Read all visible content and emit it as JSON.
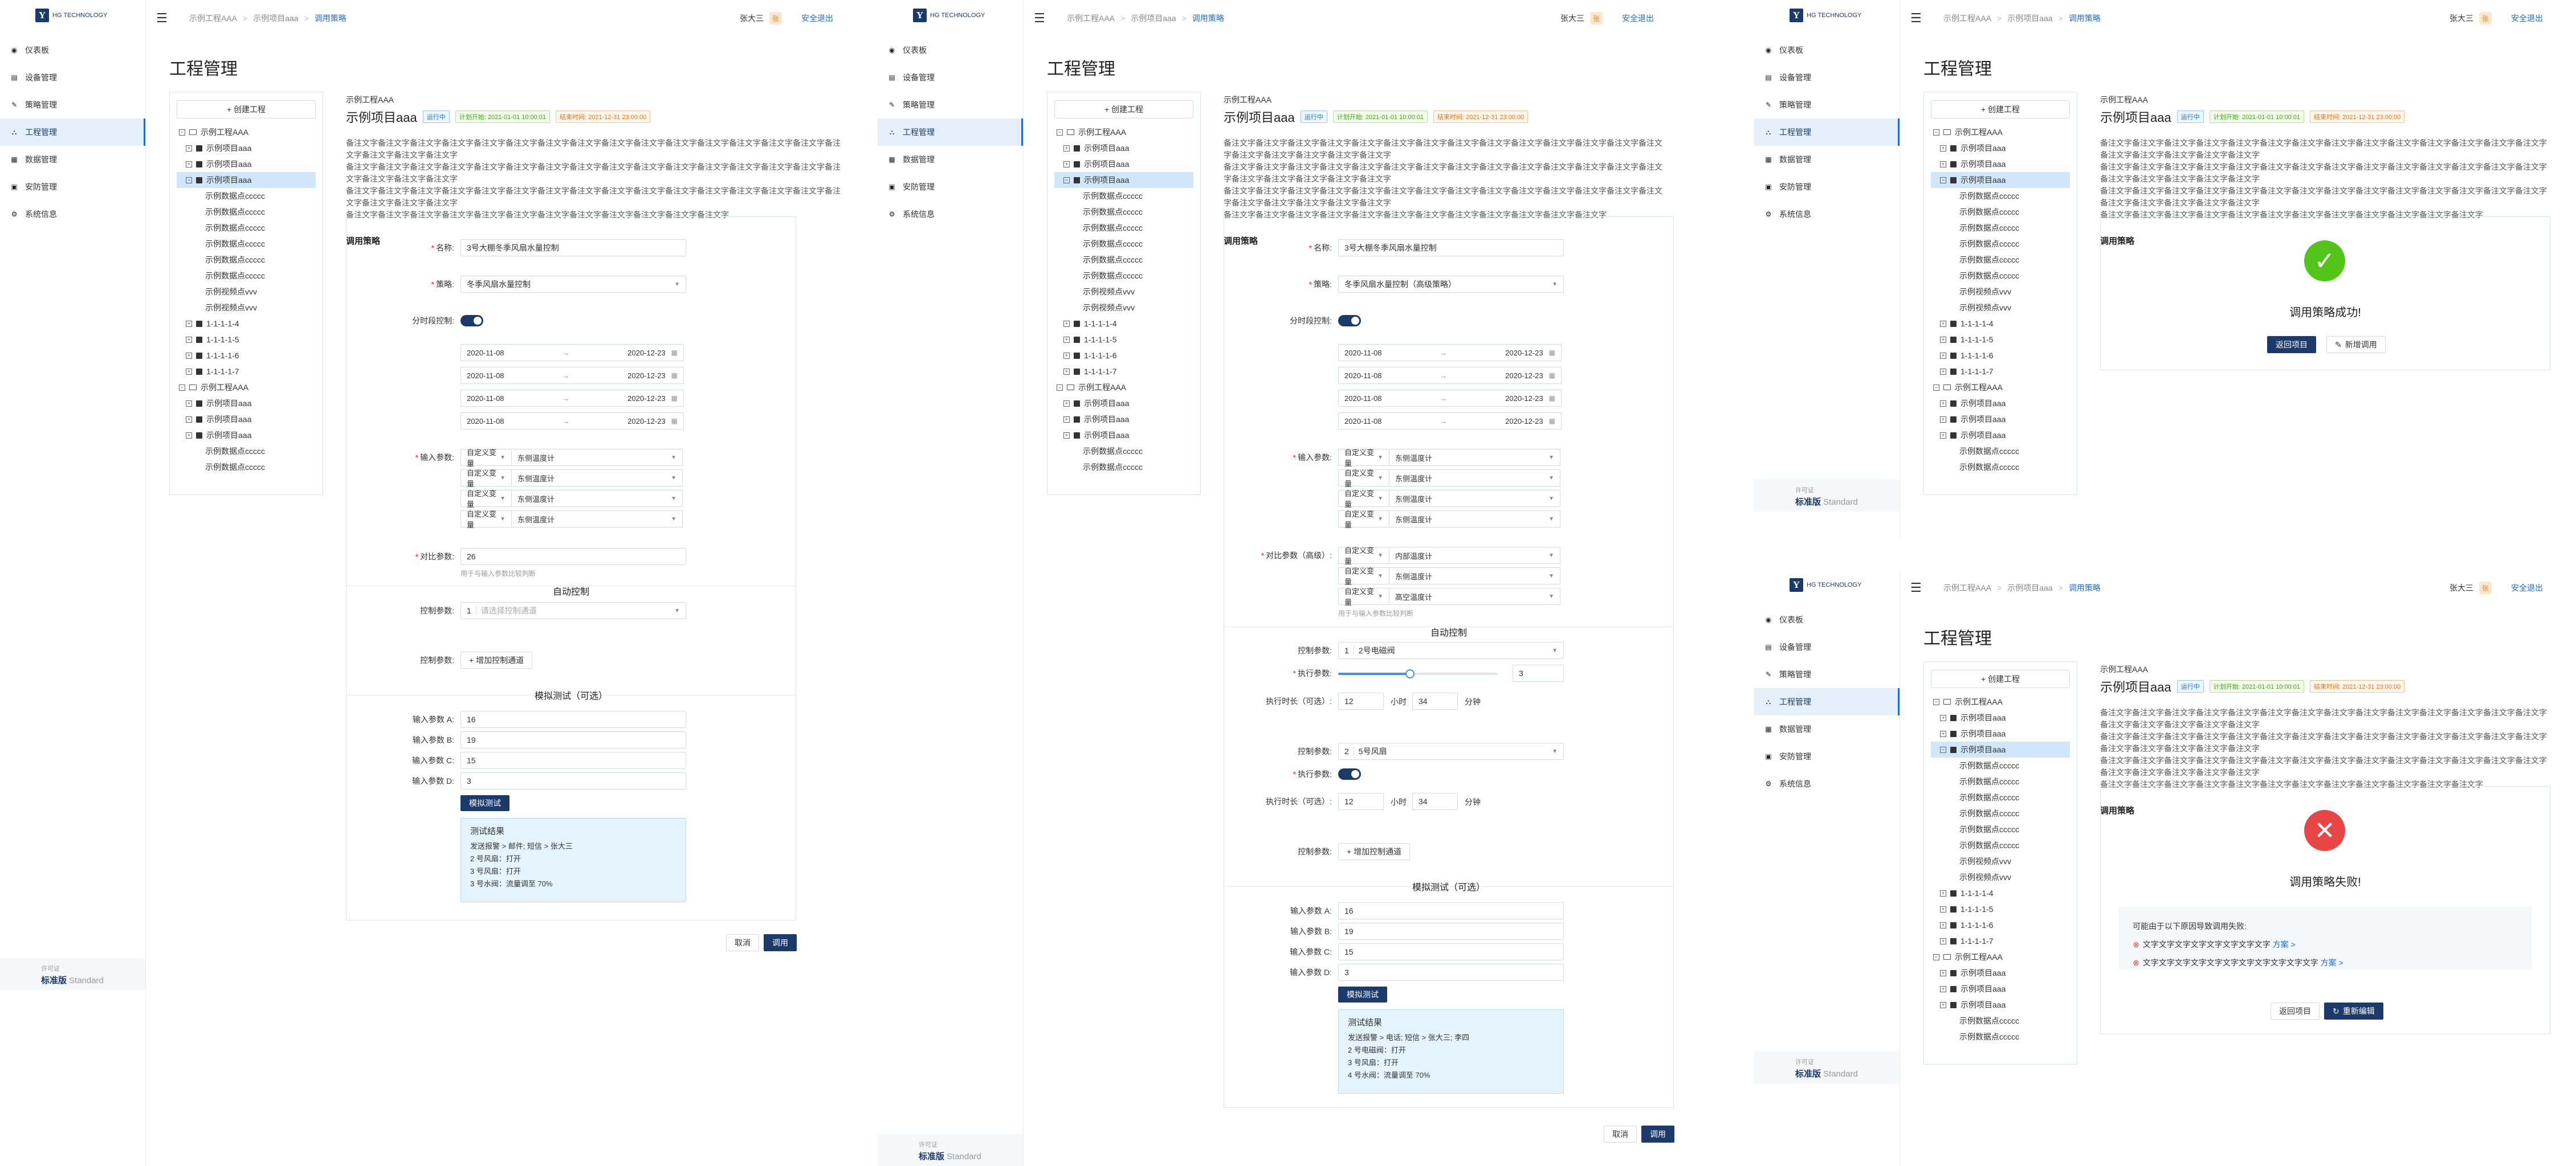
{
  "logo_text": "HG TECHNOLOGY",
  "logo_letter": "Y",
  "nav": [
    "仪表板",
    "设备管理",
    "策略管理",
    "工程管理",
    "数据管理",
    "安防管理",
    "系统信息"
  ],
  "version": {
    "label": "许可证",
    "name": "标准版",
    "sub": "Standard"
  },
  "crumbs": [
    "示例工程AAA",
    "示例项目aaa",
    "调用策略"
  ],
  "user": {
    "name": "张大三",
    "avatar": "张",
    "logout": "安全退出"
  },
  "page_title": "工程管理",
  "tree": {
    "create": "+ 创建工程",
    "nodes": [
      {
        "t": "示例工程AAA",
        "lvl": 0,
        "kind": "folder",
        "tog": "−"
      },
      {
        "t": "示例项目aaa",
        "lvl": 1,
        "kind": "sq",
        "tog": "+"
      },
      {
        "t": "示例项目aaa",
        "lvl": 1,
        "kind": "sq",
        "tog": "+"
      },
      {
        "t": "示例项目aaa",
        "lvl": 1,
        "kind": "sq",
        "tog": "−",
        "sel": true
      },
      {
        "t": "示例数据点ccccc",
        "lvl": 2
      },
      {
        "t": "示例数据点ccccc",
        "lvl": 2
      },
      {
        "t": "示例数据点ccccc",
        "lvl": 2
      },
      {
        "t": "示例数据点ccccc",
        "lvl": 2
      },
      {
        "t": "示例数据点ccccc",
        "lvl": 2
      },
      {
        "t": "示例数据点ccccc",
        "lvl": 2
      },
      {
        "t": "示例视频点vvv",
        "lvl": 2
      },
      {
        "t": "示例视频点vvv",
        "lvl": 2
      },
      {
        "t": "1-1-1-1-4",
        "lvl": 1,
        "kind": "sq",
        "tog": "+"
      },
      {
        "t": "1-1-1-1-5",
        "lvl": 1,
        "kind": "sq",
        "tog": "+"
      },
      {
        "t": "1-1-1-1-6",
        "lvl": 1,
        "kind": "sq",
        "tog": "+"
      },
      {
        "t": "1-1-1-1-7",
        "lvl": 1,
        "kind": "sq",
        "tog": "+"
      },
      {
        "t": "示例工程AAA",
        "lvl": 0,
        "kind": "folder",
        "tog": "−"
      },
      {
        "t": "示例项目aaa",
        "lvl": 1,
        "kind": "sq",
        "tog": "+"
      },
      {
        "t": "示例项目aaa",
        "lvl": 1,
        "kind": "sq",
        "tog": "+"
      },
      {
        "t": "示例项目aaa",
        "lvl": 1,
        "kind": "sq",
        "tog": "+"
      },
      {
        "t": "示例数据点ccccc",
        "lvl": 2
      },
      {
        "t": "示例数据点ccccc",
        "lvl": 2
      }
    ]
  },
  "context": {
    "project": "示例工程AAA",
    "title": "示例项目aaa",
    "status": "运行中",
    "planned": "计划开始: 2021-01-01 10:00:01",
    "deadline": "结束时间: 2021-12-31 23:00:00",
    "desc1": "备注文字备注文字备注文字备注文字备注文字备注文字备注文字备注文字备注文字备注文字备注文字备注文字备注文字备注文字备注文字备注文字备注文字备注文字备注文字",
    "desc2": "备注文字备注文字备注文字备注文字备注文字备注文字备注文字备注文字备注文字备注文字备注文字备注文字备注文字备注文字备注文字备注文字备注文字备注文字备注文字",
    "desc3": "备注文字备注文字备注文字备注文字备注文字备注文字备注文字备注文字备注文字备注文字备注文字备注文字备注文字备注文字备注文字备注文字备注文字备注文字备注文字",
    "desc4": "备注文字备注文字备注文字备注文字备注文字备注文字备注文字备注文字备注文字备注文字备注文字备注文字",
    "section": "调用策略"
  },
  "form": {
    "name_label": "名称:",
    "name_value": "3号大棚冬季风扇水量控制",
    "strategy_label": "策略:",
    "strategy_value": "冬季风扇水量控制",
    "strategy_value_adv": "冬季风扇水量控制（高级策略）",
    "timectl_label": "分时段控制:",
    "dates": [
      [
        "2020-11-08",
        "2020-12-23"
      ],
      [
        "2020-11-08",
        "2020-12-23"
      ],
      [
        "2020-11-08",
        "2020-12-23"
      ],
      [
        "2020-11-08",
        "2020-12-23"
      ]
    ],
    "input_label": "输入参数:",
    "inputs": [
      [
        "自定义变量",
        "东侧温度计"
      ],
      [
        "自定义变量",
        "东侧温度计"
      ],
      [
        "自定义变量",
        "东侧温度计"
      ],
      [
        "自定义变量",
        "东侧温度计"
      ]
    ],
    "compare_label": "对比参数:",
    "compare_value": "26",
    "compare_hint": "用于与输入参数比较判断",
    "compare_label_adv": "对比参数（高级）:",
    "compare_adv": [
      [
        "自定义变量",
        "内部温度计"
      ],
      [
        "自定义变量",
        "东侧温度计"
      ],
      [
        "自定义变量",
        "高空温度计"
      ]
    ],
    "auto_title": "自动控制",
    "ctrl_label": "控制参数:",
    "ctrl_num": "1",
    "ctrl_placeholder": "请选择控制通道",
    "ctrl2_label": "控制参数:",
    "add_ctrl": "+ 增加控制通道",
    "exec_label": "执行参数:",
    "exec_value": "3",
    "ctrl1_value": "2号电磁阀",
    "ctrl2_num": "2",
    "ctrl2_value": "5号风扇",
    "exec_time_label": "执行时长（可选）:",
    "hours": "12",
    "hours_unit": "小时",
    "mins": "34",
    "mins_unit": "分钟",
    "sim_title": "模拟测试（可选）",
    "sim": [
      [
        "输入参数 A:",
        "16"
      ],
      [
        "输入参数 B:",
        "19"
      ],
      [
        "输入参数 C:",
        "15"
      ],
      [
        "输入参数 D:",
        "3"
      ]
    ],
    "sim_btn": "模拟测试",
    "result_title": "测试结果",
    "result_lines": [
      "发送报警 > 邮件; 短信 > 张大三",
      "2 号风扇：打开",
      "3 号风扇：打开",
      "3 号水阀：流量调至 70%"
    ],
    "result_lines_adv": [
      "发送报警 > 电话; 短信 > 张大三; 李四",
      "2 号电磁阀：打开",
      "3 号风扇：打开",
      "4 号水阀：流量调至 70%"
    ],
    "cancel": "取消",
    "submit": "调用"
  },
  "success": {
    "title": "调用策略成功!",
    "back": "返回项目",
    "again": "新增调用"
  },
  "fail": {
    "title": "调用策略失败!",
    "reason_title": "可能由于以下原因导致调用失败:",
    "reasons": [
      "文字文字文字文字文字文字文字文字",
      "文字文字文字文字文字文字文字文字文字文字文字"
    ],
    "link": "方案 >",
    "back": "返回项目",
    "retry": "重新编辑"
  },
  "colors": {
    "primary": "#1b3a6b",
    "accent": "#1e6ec9",
    "success": "#52c41a",
    "error": "#e84545"
  }
}
